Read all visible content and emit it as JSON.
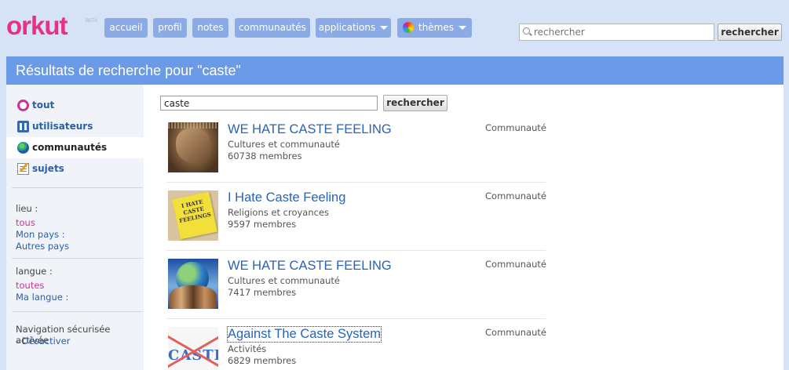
{
  "app": {
    "logo": "orkut",
    "logo_badge": "BETA"
  },
  "nav": {
    "items": [
      {
        "label": "accueil"
      },
      {
        "label": "profil"
      },
      {
        "label": "notes"
      },
      {
        "label": "communautés"
      },
      {
        "label": "applications",
        "has_dropdown": true
      },
      {
        "label": "thèmes",
        "has_dropdown": true,
        "icon": "color-wheel-icon"
      }
    ]
  },
  "top_search": {
    "placeholder": "rechercher",
    "button": "rechercher"
  },
  "panel": {
    "title": "Résultats de recherche pour \"caste\""
  },
  "sidebar": {
    "items": [
      {
        "label": "tout",
        "icon": "circle-icon",
        "active": false
      },
      {
        "label": "utilisateurs",
        "icon": "users-icon",
        "active": false
      },
      {
        "label": "communautés",
        "icon": "globe-icon",
        "active": true
      },
      {
        "label": "sujets",
        "icon": "topics-icon",
        "active": false
      }
    ],
    "location": {
      "heading": "lieu :",
      "options": [
        "tous",
        "Mon pays :",
        "Autres pays"
      ]
    },
    "language": {
      "heading": "langue :",
      "options": [
        "toutes",
        "Ma langue :"
      ]
    },
    "safe": {
      "text": "Navigation sécurisée activée",
      "link": "- Désactiver"
    }
  },
  "search": {
    "value": "caste",
    "button": "rechercher"
  },
  "results": [
    {
      "title": "WE HATE CASTE FEELING",
      "category": "Cultures et communauté",
      "members": "60738 membres",
      "type": "Communauté"
    },
    {
      "title": "I Hate Caste Feeling",
      "category": "Religions et croyances",
      "members": "9597 membres",
      "type": "Communauté",
      "thumb_text": "I HATE CASTE FEELINGS"
    },
    {
      "title": "WE HATE CASTE FEELING",
      "category": "Cultures et communauté",
      "members": "7417 membres",
      "type": "Communauté"
    },
    {
      "title": "Against The Caste System",
      "category": "Activités",
      "members": "6829 membres",
      "type": "Communauté",
      "thumb_text": "CASTE"
    }
  ],
  "colors": {
    "accent": "#6b9be8",
    "nav_button": "#8aabe6",
    "logo": "#e8308a",
    "link": "#2a62b4",
    "magenta_link": "#cc3399"
  }
}
